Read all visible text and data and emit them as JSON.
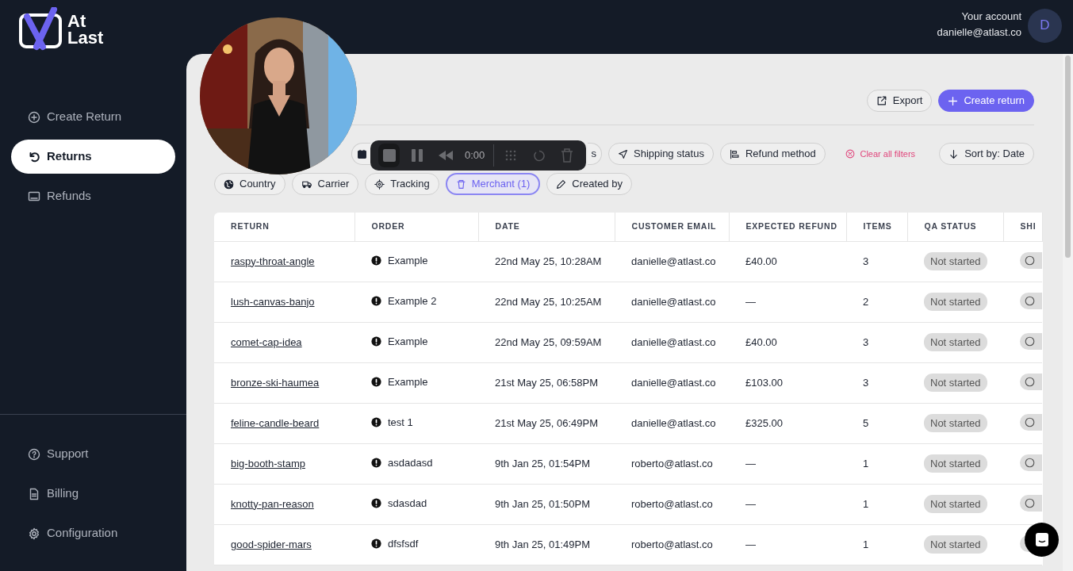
{
  "logo": {
    "lines": [
      "At",
      "Last"
    ]
  },
  "account": {
    "label": "Your account",
    "email": "danielle@atlast.co",
    "initial": "D"
  },
  "sidebar": {
    "items": [
      {
        "label": "Create Return",
        "selected": false
      },
      {
        "label": "Returns",
        "selected": true
      },
      {
        "label": "Refunds",
        "selected": false
      }
    ],
    "bottom_items": [
      {
        "label": "Support"
      },
      {
        "label": "Billing"
      },
      {
        "label": "Configuration"
      }
    ]
  },
  "actions": [
    {
      "label": "Export",
      "kind": "secondary"
    },
    {
      "label": "Create return",
      "kind": "primary"
    }
  ],
  "filters": [
    [
      {
        "selected": false
      },
      {
        "label": "s",
        "selected": false
      },
      {
        "label": "Shipping status",
        "selected": false
      },
      {
        "label": "Refund method",
        "selected": false
      }
    ],
    [
      {
        "label": "Country",
        "selected": false
      },
      {
        "label": "Carrier",
        "selected": false
      },
      {
        "label": "Tracking",
        "selected": false
      },
      {
        "label": "Merchant (1)",
        "selected": true
      },
      {
        "label": "Created by",
        "selected": false
      }
    ]
  ],
  "clear_filters": "Clear all filters",
  "sort": "Sort by: Date",
  "recorder": {
    "time": "0:00"
  },
  "table": {
    "columns": [
      "RETURN",
      "ORDER",
      "DATE",
      "CUSTOMER EMAIL",
      "EXPECTED REFUND",
      "ITEMS",
      "QA STATUS",
      "SHI"
    ],
    "rows": [
      {
        "return": "raspy-throat-angle",
        "order": "Example",
        "date": "22nd May 25, 10:28AM",
        "email": "danielle@atlast.co",
        "refund": "£40.00",
        "items": "3",
        "qa_status": "Not started"
      },
      {
        "return": "lush-canvas-banjo",
        "order": "Example 2",
        "date": "22nd May 25, 10:25AM",
        "email": "danielle@atlast.co",
        "refund": "—",
        "items": "2",
        "qa_status": "Not started"
      },
      {
        "return": "comet-cap-idea",
        "order": "Example",
        "date": "22nd May 25, 09:59AM",
        "email": "danielle@atlast.co",
        "refund": "£40.00",
        "items": "3",
        "qa_status": "Not started"
      },
      {
        "return": "bronze-ski-haumea",
        "order": "Example",
        "date": "21st May 25, 06:58PM",
        "email": "danielle@atlast.co",
        "refund": "£103.00",
        "items": "3",
        "qa_status": "Not started"
      },
      {
        "return": "feline-candle-beard",
        "order": "test 1",
        "date": "21st May 25, 06:49PM",
        "email": "danielle@atlast.co",
        "refund": "£325.00",
        "items": "5",
        "qa_status": "Not started"
      },
      {
        "return": "big-booth-stamp",
        "order": "asdadasd",
        "date": "9th Jan 25, 01:54PM",
        "email": "roberto@atlast.co",
        "refund": "—",
        "items": "1",
        "qa_status": "Not started"
      },
      {
        "return": "knotty-pan-reason",
        "order": "sdasdad",
        "date": "9th Jan 25, 01:50PM",
        "email": "roberto@atlast.co",
        "refund": "—",
        "items": "1",
        "qa_status": "Not started"
      },
      {
        "return": "good-spider-mars",
        "order": "dfsfsdf",
        "date": "9th Jan 25, 01:49PM",
        "email": "roberto@atlast.co",
        "refund": "—",
        "items": "1",
        "qa_status": "Not started"
      }
    ]
  }
}
